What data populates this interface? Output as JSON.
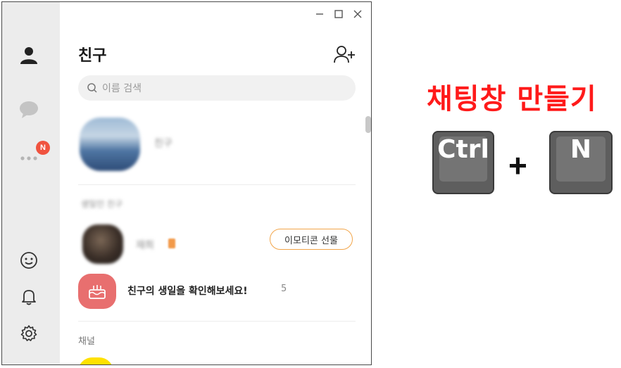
{
  "window": {
    "title": "친구",
    "search_placeholder": "이름 검색",
    "friend_name_blurred": "친구",
    "birthday_section_blurred": "생일인 친구",
    "birthday_friend_blurred": "재희",
    "emoticon_gift_label": "이모티콘 선물",
    "birthday_prompt": "친구의 생일을 확인해보세요!",
    "birthday_count": "5",
    "channel_label": "채널",
    "notification_badge": "N"
  },
  "annotation": {
    "heading": "채팅창 만들기",
    "key1": "Ctrl",
    "plus": "+",
    "key2": "N"
  },
  "colors": {
    "heading_red": "#ff1a1a",
    "badge_red": "#f0533f",
    "emoticon_border": "#f2a54a",
    "cake_bg": "#e86f6f",
    "channel_yellow": "#ffe100"
  }
}
